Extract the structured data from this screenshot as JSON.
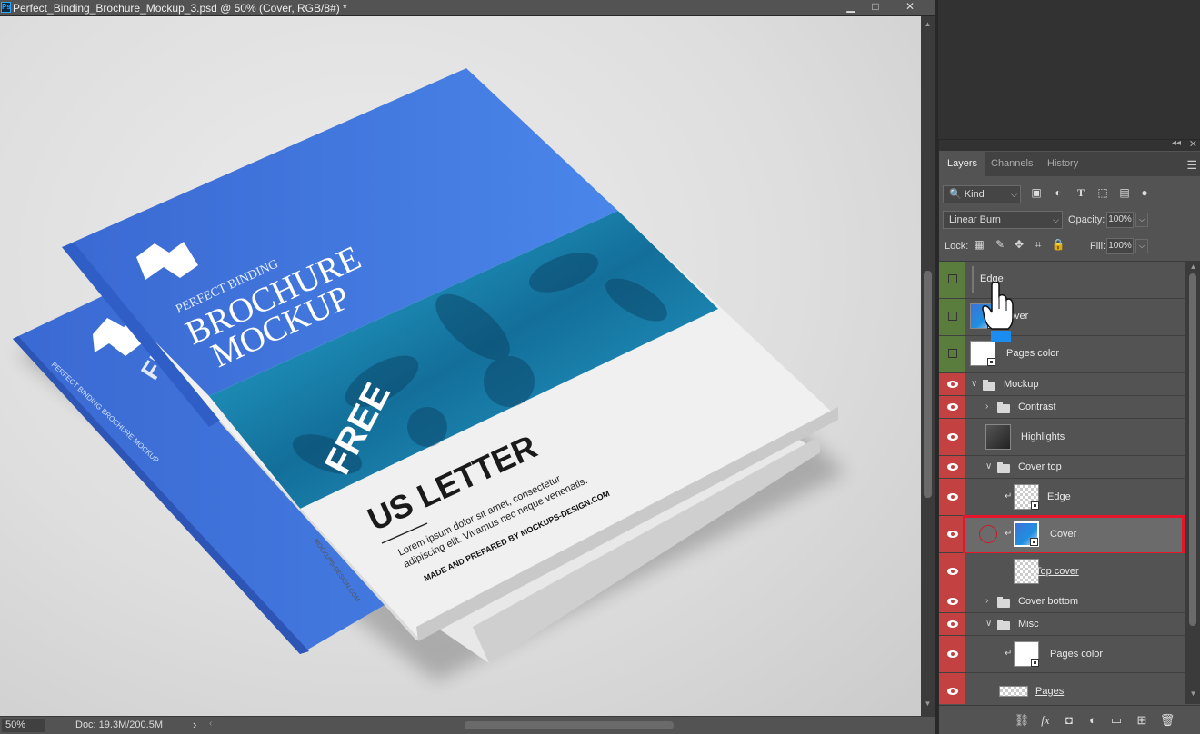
{
  "document": {
    "title": "Perfect_Binding_Brochure_Mockup_3.psd @ 50% (Cover, RGB/8#) *",
    "window_buttons": {
      "minimize": "▁",
      "maximize": "□",
      "close": "✕"
    },
    "status": {
      "zoom": "50%",
      "doc_size": "Doc: 19.3M/200.5M",
      "arrow": "›"
    }
  },
  "mockup_artwork": {
    "brand": "PERFECT BINDING",
    "headline_1": "BROCHURE",
    "headline_2": "MOCKUP",
    "free_badge": "FREE",
    "size_title": "US LETTER",
    "body_1": "Lorem ipsum dolor sit amet, consectetur",
    "body_2": "adipiscing elit. Vivamus nec neque venenatis.",
    "credit": "MADE AND PREPARED BY MOCKUPS-DESIGN.COM",
    "spine_text": "PERFECT BINDING BROCHURE MOCKUP",
    "spine_site": "MOCKUPS-DESIGN.COM",
    "colors": {
      "cover_blue": "#3b6fd8",
      "photo_teal": "#1fa3c8"
    }
  },
  "layers_panel": {
    "tabs": [
      {
        "label": "Layers",
        "active": true
      },
      {
        "label": "Channels",
        "active": false
      },
      {
        "label": "History",
        "active": false
      }
    ],
    "filter": {
      "kind": "Kind",
      "icons": [
        "image-filter-icon",
        "adjustment-filter-icon",
        "type-filter-icon",
        "shape-filter-icon",
        "smart-object-filter-icon",
        "filter-toggle-icon"
      ]
    },
    "blend_mode": "Linear Burn",
    "opacity_label": "Opacity:",
    "opacity": "100%",
    "lock_label": "Lock:",
    "fill_label": "Fill:",
    "fill": "100%",
    "layers": [
      {
        "name": "Edge",
        "visible": false,
        "kind": "edge"
      },
      {
        "name": "Cover",
        "visible": false,
        "kind": "blue-smart"
      },
      {
        "name": "Pages color",
        "visible": false,
        "kind": "white-smart"
      },
      {
        "name": "Mockup",
        "visible": true,
        "kind": "group-open"
      },
      {
        "name": "Contrast",
        "visible": true,
        "kind": "group-closed"
      },
      {
        "name": "Highlights",
        "visible": true,
        "kind": "dark"
      },
      {
        "name": "Cover top",
        "visible": true,
        "kind": "group-open"
      },
      {
        "name": "Edge",
        "visible": true,
        "kind": "checker-smart"
      },
      {
        "name": "Cover",
        "visible": true,
        "kind": "blue-smart-selected"
      },
      {
        "name": "Top cover",
        "visible": true,
        "kind": "checker"
      },
      {
        "name": "Cover bottom",
        "visible": true,
        "kind": "group-closed"
      },
      {
        "name": "Misc",
        "visible": true,
        "kind": "group-open"
      },
      {
        "name": "Pages color",
        "visible": true,
        "kind": "white-smart"
      },
      {
        "name": "Pages",
        "visible": true,
        "kind": "checker"
      }
    ],
    "highlight_color": "#e5162b",
    "footer_icons": [
      "link-layers-icon",
      "fx-icon",
      "layer-mask-icon",
      "adjustment-layer-icon",
      "new-group-icon",
      "new-layer-icon",
      "trash-icon"
    ],
    "footer_glyphs": {
      "link": "⛓",
      "fx": "fx",
      "mask": "◘",
      "adjust": "◐",
      "group": "▭",
      "new": "⊞",
      "trash": "🗑"
    }
  }
}
